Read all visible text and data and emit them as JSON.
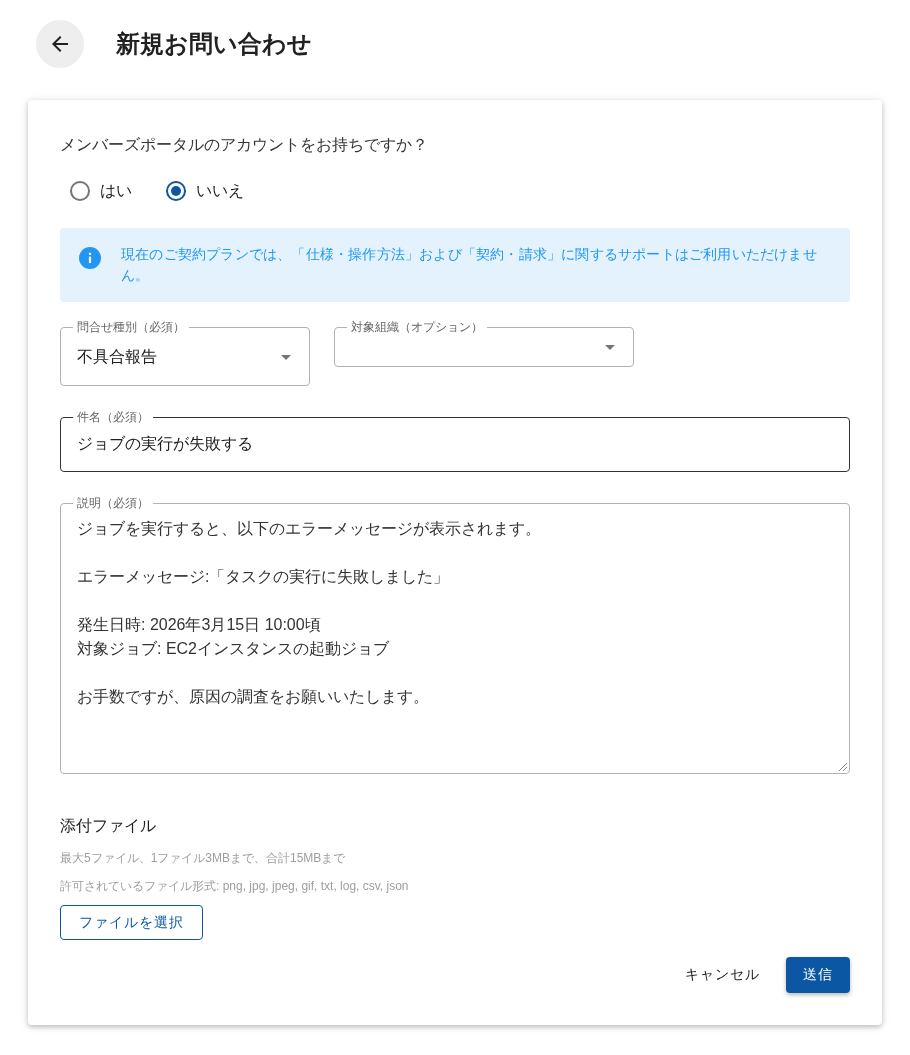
{
  "header": {
    "title": "新規お問い合わせ"
  },
  "form": {
    "account_question": {
      "label": "メンバーズポータルのアカウントをお持ちですか？",
      "options": [
        {
          "label": "はい",
          "selected": false
        },
        {
          "label": "いいえ",
          "selected": true
        }
      ]
    },
    "notice": {
      "text": "現在のご契約プランでは、「仕様・操作方法」および「契約・請求」に関するサポートはご利用いただけません。"
    },
    "inquiry_type": {
      "label": "問合せ種別（必須）",
      "value": "不具合報告",
      "hovered": false
    },
    "organization": {
      "label": "対象組織（オプション）",
      "hovered": false
    },
    "subject": {
      "label": "件名（必須）",
      "value": "ジョブの実行が失敗する",
      "hovered": true
    },
    "description": {
      "label": "説明（必須）",
      "paragraphs": [
        [
          "ジョブを実行すると、以下のエラーメッセージが表示されます。"
        ],
        [
          "エラーメッセージ:「タスクの実行に失敗しました」"
        ],
        [
          "発生日時: 2026年3月15日 10:00頃",
          "対象ジョブ: EC2インスタンスの起動ジョブ"
        ],
        [
          "お手数ですが、原因の調査をお願いいたします。"
        ]
      ],
      "hovered": false
    },
    "attachments": {
      "title": "添付ファイル",
      "notes": [
        "最大5ファイル、1ファイル3MBまで、合計15MBまで",
        "許可されているファイル形式: png, jpg, jpeg, gif, txt, log, csv, json"
      ],
      "button": "ファイルを選択"
    },
    "actions": [
      {
        "label": "キャンセル",
        "kind": "text"
      },
      {
        "label": "送信",
        "kind": "primary"
      }
    ]
  }
}
